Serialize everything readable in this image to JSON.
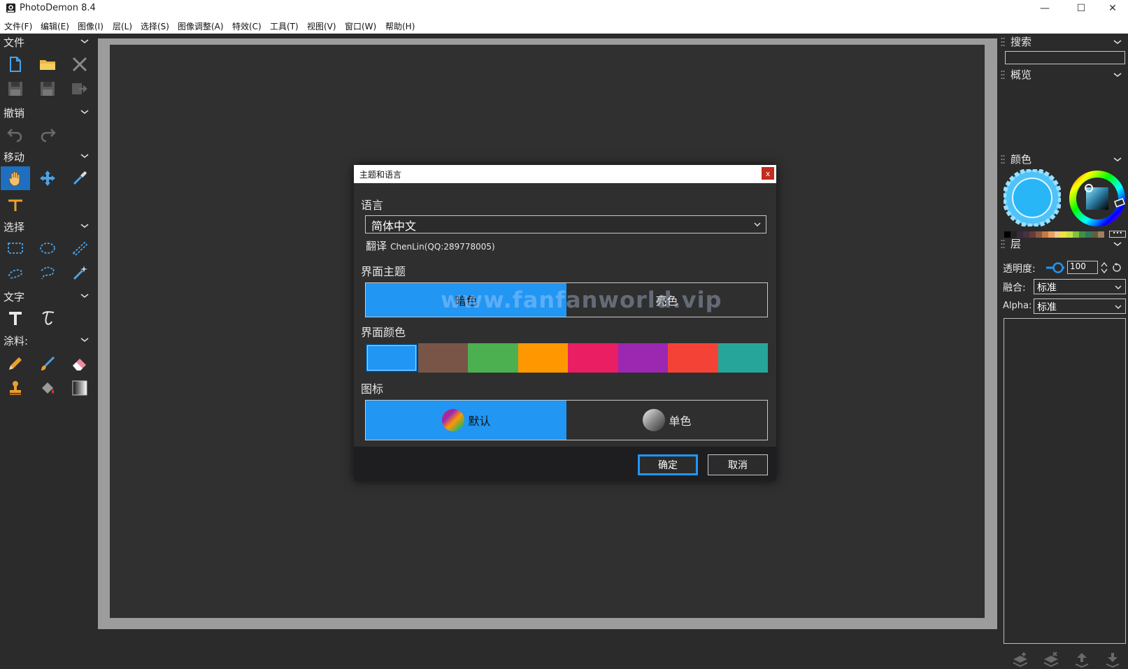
{
  "window": {
    "title": "PhotoDemon 8.4",
    "minimize": "—",
    "maximize": "☐",
    "close": "✕"
  },
  "menu": [
    "文件(F)",
    "编辑(E)",
    "图像(I)",
    "层(L)",
    "选择(S)",
    "图像调整(A)",
    "特效(C)",
    "工具(T)",
    "视图(V)",
    "窗口(W)",
    "帮助(H)"
  ],
  "toolbox": {
    "file": "文件",
    "undo": "撤销",
    "move": "移动",
    "select": "选择",
    "text": "文字",
    "paint": "涂料:"
  },
  "right_panel": {
    "search": "搜索",
    "overview": "概览",
    "colors": "颜色",
    "layers": "层",
    "opacity_label": "透明度:",
    "opacity_value": "100",
    "blend_label": "融合:",
    "blend_value": "标准",
    "alpha_label": "Alpha:",
    "alpha_value": "标准",
    "palette": [
      "#000000",
      "#222222",
      "#3a2a3a",
      "#4a3040",
      "#6a3a3a",
      "#8a5a40",
      "#c87840",
      "#e8a060",
      "#f0c890",
      "#f0e040",
      "#c8e040",
      "#80c040",
      "#409040",
      "#307860",
      "#606040",
      "#a08060"
    ]
  },
  "dialog": {
    "title": "主题和语言",
    "close": "x",
    "language_label": "语言",
    "language_value": "简体中文",
    "translator_label": "翻译",
    "translator_value": "ChenLin(QQ:289778005)",
    "theme_label": "界面主题",
    "theme_dark": "暗色",
    "theme_light": "亮色",
    "accent_label": "界面颜色",
    "accent_colors": [
      "#2196f3",
      "#795548",
      "#4caf50",
      "#ff9800",
      "#e91e63",
      "#9c27b0",
      "#f44336",
      "#26a69a"
    ],
    "icons_label": "图标",
    "icons_default": "默认",
    "icons_mono": "单色",
    "ok": "确定",
    "cancel": "取消"
  },
  "watermark": "www.fanfanworld.vip"
}
